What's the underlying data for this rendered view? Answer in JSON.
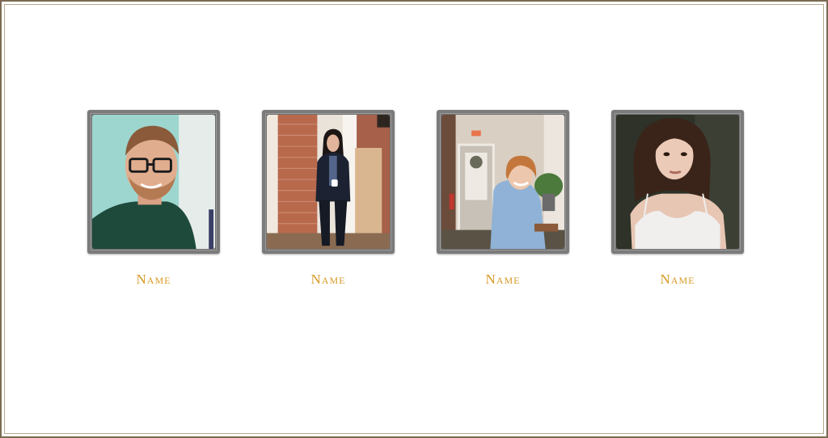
{
  "team": {
    "members": [
      {
        "name": "Name",
        "photo_icon": "portrait-photo"
      },
      {
        "name": "Name",
        "photo_icon": "portrait-photo"
      },
      {
        "name": "Name",
        "photo_icon": "portrait-photo"
      },
      {
        "name": "Name",
        "photo_icon": "portrait-photo"
      }
    ]
  },
  "colors": {
    "name_text": "#d79a25",
    "frame_border": "#7a6a52",
    "photo_border": "#7b7b7b"
  }
}
